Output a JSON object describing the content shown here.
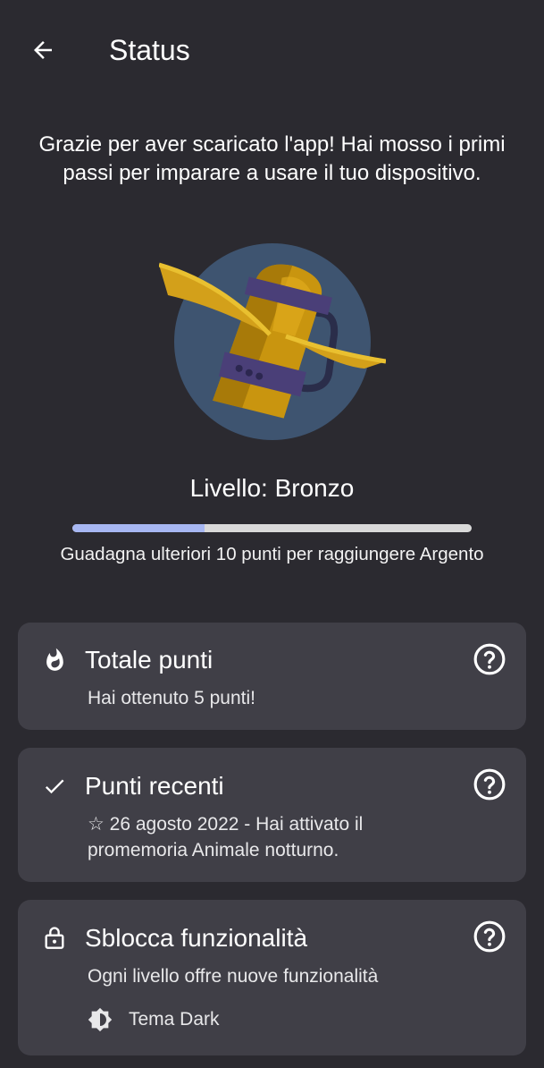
{
  "header": {
    "title": "Status",
    "back_icon": "arrow-left-icon"
  },
  "intro": {
    "text": "Grazie per aver scaricato l'app! Hai mosso i primi passi per imparare a usare il tuo dispositivo."
  },
  "badge": {
    "icon": "bronze-badge-icon"
  },
  "level": {
    "label": "Livello: Bronzo",
    "progress": 0.33,
    "progress_text": "Guadagna ulteriori 10 punti per raggiungere Argento"
  },
  "cards": {
    "total": {
      "title": "Totale punti",
      "text": "Hai ottenuto 5 punti!",
      "icon": "flame-icon"
    },
    "recent": {
      "title": "Punti recenti",
      "text": "☆ 26 agosto 2022 - Hai attivato il promemoria Animale notturno.",
      "icon": "check-icon"
    },
    "unlock": {
      "title": "Sblocca funzionalità",
      "text": "Ogni livello offre nuove funzionalità",
      "icon": "lock-icon",
      "feature_label": "Tema Dark",
      "feature_icon": "brightness-icon"
    }
  },
  "colors": {
    "background": "#2b2a30",
    "card": "#403f47",
    "progress_fill": "#a7b7f2",
    "progress_track": "#d9d9d9",
    "badge_circle": "#3e5470",
    "gold": "#c9950f"
  }
}
